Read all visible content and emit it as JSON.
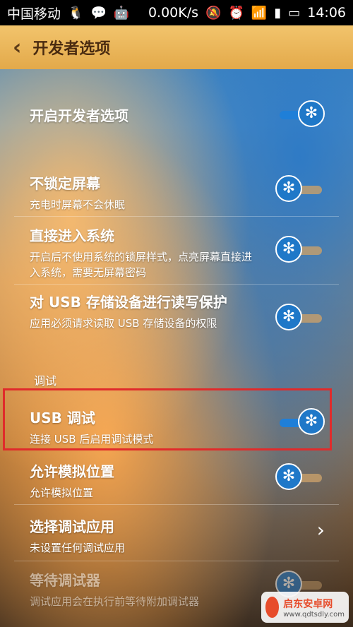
{
  "status_bar": {
    "carrier": "中国移动",
    "network_speed": "0.00K/s",
    "time": "14:06",
    "icons": [
      "qq-icon",
      "chat-icon",
      "android-icon",
      "mute-icon",
      "alarm-icon",
      "wifi-icon",
      "signal-icon",
      "battery-icon"
    ]
  },
  "title_bar": {
    "back_icon": "back-icon",
    "title": "开发者选项"
  },
  "rows": [
    {
      "title": "开启开发者选项",
      "subtitle": "",
      "toggle": "on"
    },
    {
      "title": "不锁定屏幕",
      "subtitle": "充电时屏幕不会休眠",
      "toggle": "off"
    },
    {
      "title": "直接进入系统",
      "subtitle": "开启后不使用系统的锁屏样式，点亮屏幕直接进入系统，需要无屏幕密码",
      "toggle": "off"
    },
    {
      "title": "对 USB 存储设备进行读写保护",
      "subtitle": "应用必须请求读取 USB 存储设备的权限",
      "toggle": "off"
    }
  ],
  "debug_section": {
    "header": "调试",
    "rows": [
      {
        "title": "USB 调试",
        "subtitle": "连接 USB 后启用调试模式",
        "toggle": "on"
      },
      {
        "title": "允许模拟位置",
        "subtitle": "允许模拟位置",
        "toggle": "off"
      },
      {
        "title": "选择调试应用",
        "subtitle": "未设置任何调试应用",
        "control": "chevron"
      },
      {
        "title": "等待调试器",
        "subtitle": "调试应用会在执行前等待附加调试器",
        "toggle": "off-disabled"
      }
    ]
  },
  "watermark": {
    "line1": "启东安卓网",
    "line2": "www.qdtsdly.com"
  }
}
